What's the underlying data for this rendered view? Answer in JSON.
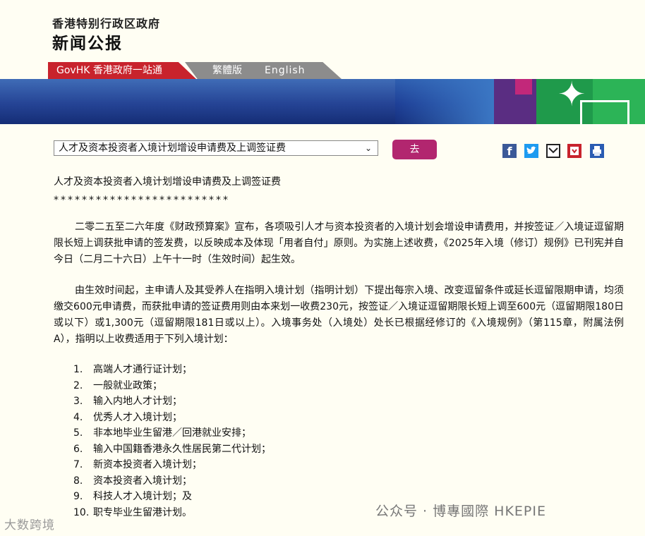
{
  "header": {
    "org_title": "香港特别行政区政府",
    "press_title": "新闻公报"
  },
  "nav": {
    "govhk": "GovHK 香港政府一站通",
    "traditional": "繁體版",
    "english": "English"
  },
  "toolbar": {
    "selected_article": "人才及资本投资者入境计划增设申请费及上调签证费",
    "go_label": "去"
  },
  "share": {
    "icons": [
      "facebook-icon",
      "twitter-icon",
      "email-icon",
      "save-icon",
      "print-icon"
    ]
  },
  "article": {
    "headline": "人才及资本投资者入境计划增设申请费及上调签证费",
    "separator": "*************************",
    "paragraphs": [
      "二零二五至二六年度《财政预算案》宣布，各项吸引人才与资本投资者的入境计划会增设申请费用，并按签证／入境证逗留期限长短上调获批申请的签发费，以反映成本及体现「用者自付」原则。为实施上述收费，《2025年入境（修订）规例》已刊宪并自今日（二月二十六日）上午十一时（生效时间）起生效。",
      "由生效时间起，主申请人及其受养人在指明入境计划（指明计划）下提出每宗入境、改变逗留条件或延长逗留限期申请，均须缴交600元申请费，而获批申请的签证费用则由本来划一收费230元，按签证／入境证逗留期限长短上调至600元（逗留期限180日或以下）或1,300元（逗留期限181日或以上）。入境事务处（入境处）处长已根据经修订的《入境规例》（第115章，附属法例A），指明以上收费适用于下列入境计划："
    ],
    "schemes": [
      {
        "num": "1.",
        "text": "高端人才通行证计划；"
      },
      {
        "num": "2.",
        "text": "一般就业政策；"
      },
      {
        "num": "3.",
        "text": "输入内地人才计划；"
      },
      {
        "num": "4.",
        "text": "优秀人才入境计划；"
      },
      {
        "num": "5.",
        "text": "非本地毕业生留港／回港就业安排；"
      },
      {
        "num": "6.",
        "text": "输入中国籍香港永久性居民第二代计划；"
      },
      {
        "num": "7.",
        "text": "新资本投资者入境计划；"
      },
      {
        "num": "8.",
        "text": "资本投资者入境计划；"
      },
      {
        "num": "9.",
        "text": "科技人才入境计划；及"
      },
      {
        "num": "10.",
        "text": "职专毕业生留港计划。"
      }
    ]
  },
  "watermarks": {
    "wechat": "公众号 · 博專國際 HKEPIE",
    "corner": "大数跨境"
  }
}
